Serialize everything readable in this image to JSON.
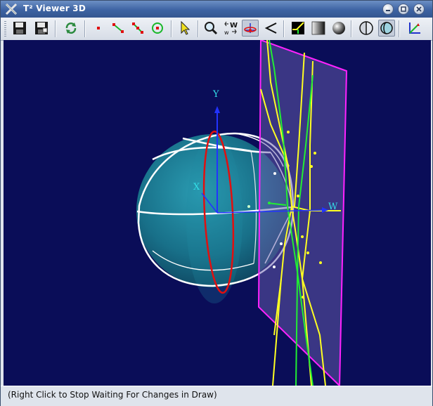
{
  "window": {
    "title": "T² Viewer 3D",
    "app_icon": "x-logo-icon",
    "controls": [
      "minimize-icon",
      "maximize-icon",
      "close-icon"
    ]
  },
  "toolbar": {
    "tools": [
      {
        "name": "save-button",
        "icon": "floppy-disk-icon"
      },
      {
        "name": "save-as-button",
        "icon": "floppy-disk-icon"
      },
      {
        "name": "refresh-button",
        "icon": "refresh-icon"
      },
      {
        "name": "show-points-button",
        "icon": "red-points-icon"
      },
      {
        "name": "show-segments-button",
        "icon": "segment-icon"
      },
      {
        "name": "show-polyline-button",
        "icon": "polyline-icon"
      },
      {
        "name": "show-circle-button",
        "icon": "green-circle-icon"
      },
      {
        "name": "select-tool-button",
        "icon": "arrow-pointer-icon"
      },
      {
        "name": "zoom-button",
        "icon": "magnifier-icon"
      },
      {
        "name": "rotate-w-button",
        "icon": "rotate-w-icon"
      },
      {
        "name": "rotate-xyz-button",
        "icon": "axes-rotate-icon"
      },
      {
        "name": "perspective-button",
        "icon": "angle-icon"
      },
      {
        "name": "wireframe-button",
        "icon": "wire-icon"
      },
      {
        "name": "gradient-shading-button",
        "icon": "gradient-icon"
      },
      {
        "name": "sphere-shading-button",
        "icon": "sphere-shade-icon"
      },
      {
        "name": "projection-a-button",
        "icon": "projection-icon"
      },
      {
        "name": "projection-b-button",
        "icon": "projection-icon"
      },
      {
        "name": "axes-button",
        "icon": "axes-icon"
      }
    ]
  },
  "viewport": {
    "background": "#0a0d58",
    "axis_labels": {
      "y": "Y",
      "x": "X",
      "w": "W"
    },
    "colors": {
      "sphere": "#1d7f98",
      "wire": "#ffffff",
      "y_axis": "#2233ff",
      "red_circle": "#e01010",
      "plane_border": "#ff22ff",
      "plane_fill": "#6a5fb0",
      "yellow_edges": "#ffff22",
      "green_edges": "#22ee33",
      "axis_label": "#33e0e8"
    }
  },
  "status": {
    "text": "(Right Click to Stop Waiting For Changes in Draw)"
  }
}
